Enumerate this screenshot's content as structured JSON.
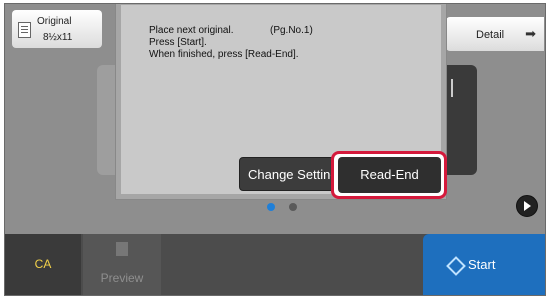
{
  "original": {
    "label": "Original",
    "size": "8½x11"
  },
  "detail": {
    "label": "Detail",
    "icon": "arrow-right-icon"
  },
  "dialog": {
    "line1": "Place next original.",
    "page_no": "(Pg.No.1)",
    "line2": "Press [Start].",
    "line3": "When finished, press [Read-End].",
    "change_label": "Change Setting",
    "read_end_label": "Read-End"
  },
  "pagination": {
    "current": 1,
    "total": 2
  },
  "bottom": {
    "ca_label": "CA",
    "preview_label": "Preview",
    "start_label": "Start"
  },
  "colors": {
    "highlight": "#d41a3c",
    "start": "#1e6fbe",
    "ca_text": "#f3d24a",
    "active_dot": "#1f7fd8"
  }
}
